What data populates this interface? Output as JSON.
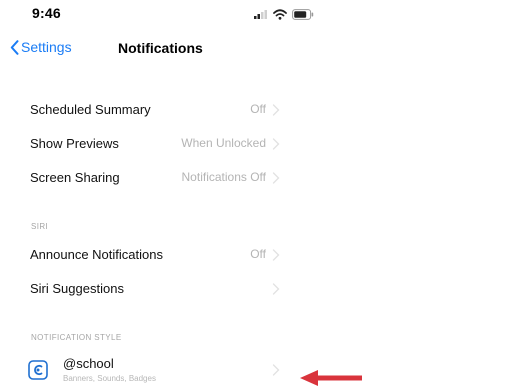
{
  "status_bar": {
    "time": "9:46"
  },
  "nav": {
    "back_label": "Settings",
    "title": "Notifications"
  },
  "general_rows": [
    {
      "label": "Scheduled Summary",
      "value": "Off"
    },
    {
      "label": "Show Previews",
      "value": "When Unlocked"
    },
    {
      "label": "Screen Sharing",
      "value": "Notifications Off"
    }
  ],
  "siri_section": {
    "header": "SIRI",
    "rows": [
      {
        "label": "Announce Notifications",
        "value": "Off"
      },
      {
        "label": "Siri Suggestions",
        "value": ""
      }
    ]
  },
  "notification_style": {
    "header": "NOTIFICATION STYLE",
    "app": {
      "name": "@school",
      "subtitle": "Banners, Sounds, Badges"
    }
  },
  "colors": {
    "accent": "#1a7cf5",
    "annotation_arrow": "#d9343c"
  },
  "icons": {
    "back": "chevron-left-icon",
    "row_disclosure": "chevron-right-icon",
    "app": "school-app-icon",
    "status": [
      "cellular-signal-icon",
      "wifi-icon",
      "battery-icon"
    ]
  }
}
